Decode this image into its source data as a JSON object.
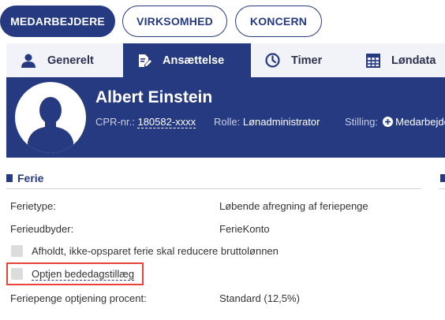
{
  "top_nav": {
    "buttons": [
      {
        "label": "MEDARBEJDERE",
        "active": true
      },
      {
        "label": "VIRKSOMHED",
        "active": false
      },
      {
        "label": "KONCERN",
        "active": false
      }
    ]
  },
  "tabs": [
    {
      "label": "Generelt",
      "icon": "user-icon",
      "active": false
    },
    {
      "label": "Ansættelse",
      "icon": "edit-document-icon",
      "active": true
    },
    {
      "label": "Timer",
      "icon": "clock-icon",
      "active": false
    },
    {
      "label": "Løndata",
      "icon": "table-icon",
      "active": false
    }
  ],
  "employee": {
    "name": "Albert Einstein",
    "cpr_label": "CPR-nr.:",
    "cpr_value": "180582-xxxx",
    "role_label": "Rolle:",
    "role_value": "Lønadministrator",
    "position_label": "Stilling:",
    "position_value": "Medarbejder"
  },
  "ferie": {
    "title": "Ferie",
    "fields": [
      {
        "label": "Ferietype:",
        "value": "Løbende afregning af feriepenge"
      },
      {
        "label": "Ferieudbyder:",
        "value": "FerieKonto"
      }
    ],
    "checkboxes": [
      {
        "label": "Afholdt, ikke-opsparet ferie skal reducere bruttolønnen",
        "checked": false
      },
      {
        "label": "Optjen bededagstillæg",
        "checked": false
      }
    ],
    "percent_label": "Feriepenge optjening procent:",
    "percent_value": "Standard (12,5%)"
  },
  "colors": {
    "brand": "#263a82",
    "tab_bg": "#f1f3f8",
    "highlight": "#e8423b"
  }
}
